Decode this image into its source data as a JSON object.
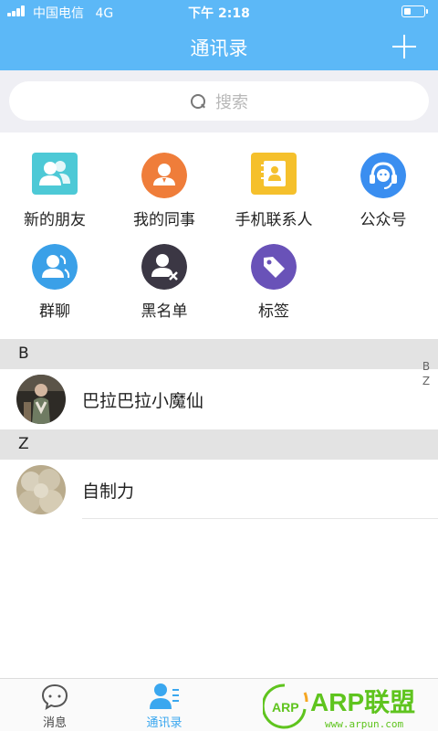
{
  "status_bar": {
    "carrier": "中国电信",
    "network": "4G",
    "time": "下午 2:18"
  },
  "header": {
    "title": "通讯录",
    "add_icon": "plus-icon"
  },
  "search": {
    "placeholder": "搜索",
    "icon": "search-icon"
  },
  "shortcuts": [
    {
      "label": "新的朋友",
      "icon": "new-friends-icon",
      "color": "#4dc9d6"
    },
    {
      "label": "我的同事",
      "icon": "colleagues-icon",
      "color": "#ef7d3a"
    },
    {
      "label": "手机联系人",
      "icon": "phone-contacts-icon",
      "color": "#f5c02c"
    },
    {
      "label": "公众号",
      "icon": "official-account-icon",
      "color": "#3a8ef0"
    },
    {
      "label": "群聊",
      "icon": "group-chat-icon",
      "color": "#3aa0e8"
    },
    {
      "label": "黑名单",
      "icon": "blacklist-icon",
      "color": "#3b3744"
    },
    {
      "label": "标签",
      "icon": "tag-icon",
      "color": "#6952b8"
    }
  ],
  "sections": [
    {
      "letter": "B",
      "contacts": [
        {
          "name": "巴拉巴拉小魔仙",
          "icon": "avatar-photo"
        }
      ]
    },
    {
      "letter": "Z",
      "contacts": [
        {
          "name": "自制力",
          "icon": "avatar-photo"
        }
      ]
    }
  ],
  "index_letters": [
    "B",
    "Z"
  ],
  "tabs": [
    {
      "label": "消息",
      "icon": "chat-bubble-icon",
      "active": false
    },
    {
      "label": "通讯录",
      "icon": "contacts-icon",
      "active": true
    }
  ],
  "watermark": {
    "logo_text": "ARP",
    "brand": "ARP联盟",
    "url": "www.arpun.com"
  },
  "colors": {
    "header": "#5cb8f7",
    "active_tab": "#3aa7ef",
    "section_header": "#e3e3e3",
    "watermark_green": "#5fc41e"
  }
}
